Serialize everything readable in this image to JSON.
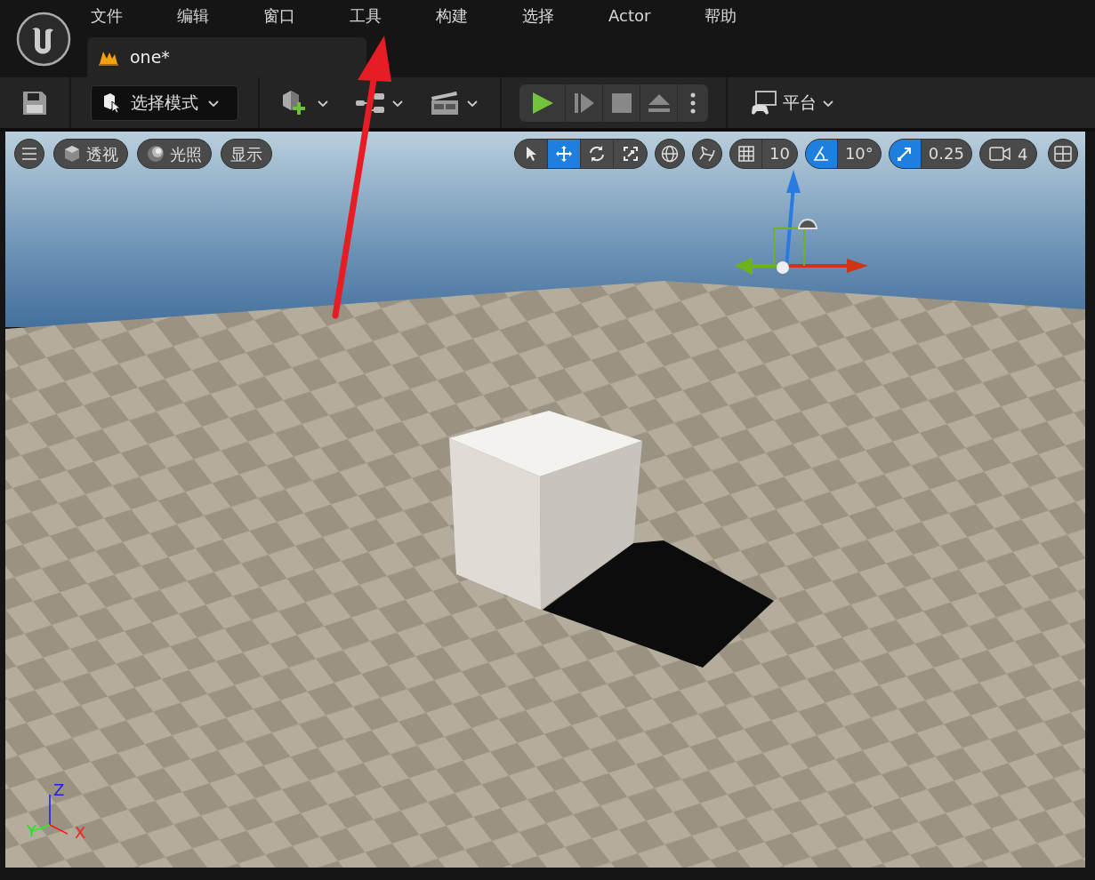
{
  "menu": [
    {
      "label": "文件"
    },
    {
      "label": "编辑"
    },
    {
      "label": "窗口"
    },
    {
      "label": "工具"
    },
    {
      "label": "构建"
    },
    {
      "label": "选择"
    },
    {
      "label": "Actor"
    },
    {
      "label": "帮助"
    }
  ],
  "document_tab": {
    "title": "one*"
  },
  "toolbar": {
    "mode_button": "选择模式",
    "platform_button": "平台"
  },
  "viewport": {
    "view_buttons": [
      {
        "kind": "perspective",
        "label": "透视"
      },
      {
        "kind": "lighting",
        "label": "光照"
      },
      {
        "kind": "show",
        "label": "显示"
      }
    ],
    "transform_tools": [
      {
        "kind": "select",
        "selected": false
      },
      {
        "kind": "translate",
        "selected": true
      },
      {
        "kind": "rotate",
        "selected": false
      },
      {
        "kind": "scale",
        "selected": false
      }
    ],
    "snaps": [
      {
        "kind": "grid",
        "value": "10",
        "on": false
      },
      {
        "kind": "angle",
        "value": "10°",
        "on": true
      },
      {
        "kind": "scale",
        "value": "0.25",
        "on": true
      }
    ],
    "camera_speed": "4",
    "axis_indicator": {
      "z": "Z",
      "y": "Y",
      "x": "X"
    }
  }
}
